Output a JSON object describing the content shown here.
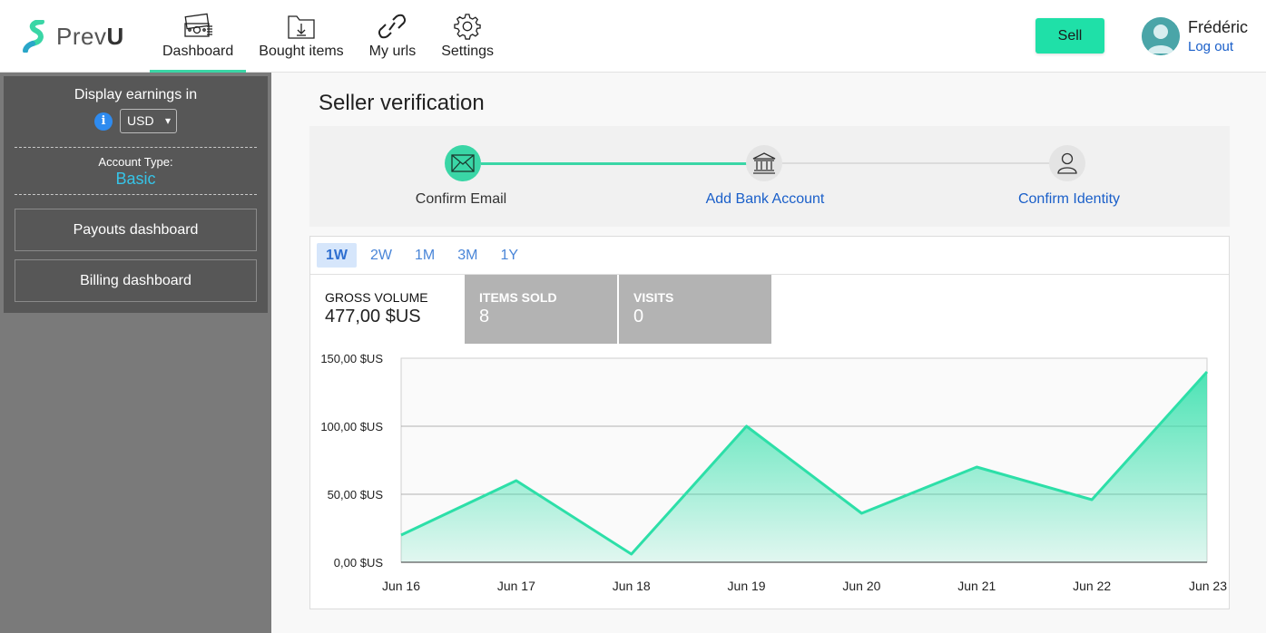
{
  "brand": {
    "name_light": "Prev",
    "name_bold": "U",
    "accent": "#3ad6a6"
  },
  "nav": [
    {
      "label": "Dashboard",
      "icon": "money-icon",
      "active": true
    },
    {
      "label": "Bought items",
      "icon": "download-folder-icon",
      "active": false
    },
    {
      "label": "My urls",
      "icon": "link-icon",
      "active": false
    },
    {
      "label": "Settings",
      "icon": "gear-icon",
      "active": false
    }
  ],
  "header": {
    "sell_label": "Sell",
    "user_name": "Frédéric",
    "logout_label": "Log out"
  },
  "sidebar": {
    "earnings_label": "Display earnings in",
    "info_glyph": "i",
    "currency": "USD",
    "account_type_label": "Account Type:",
    "account_type": "Basic",
    "buttons": [
      "Payouts dashboard",
      "Billing dashboard"
    ]
  },
  "verification": {
    "title": "Seller verification",
    "steps": [
      {
        "label": "Confirm Email",
        "icon": "envelope-icon",
        "done": true
      },
      {
        "label": "Add Bank Account",
        "icon": "bank-icon",
        "done": false
      },
      {
        "label": "Confirm Identity",
        "icon": "person-icon",
        "done": false
      }
    ]
  },
  "ranges": [
    {
      "label": "1W",
      "active": true
    },
    {
      "label": "2W",
      "active": false
    },
    {
      "label": "1M",
      "active": false
    },
    {
      "label": "3M",
      "active": false
    },
    {
      "label": "1Y",
      "active": false
    }
  ],
  "metrics": [
    {
      "label": "GROSS VOLUME",
      "value": "477,00 $US",
      "active": true
    },
    {
      "label": "ITEMS SOLD",
      "value": "8",
      "active": false
    },
    {
      "label": "VISITS",
      "value": "0",
      "active": false
    }
  ],
  "chart_data": {
    "type": "area",
    "x": [
      "Jun 16",
      "Jun 17",
      "Jun 18",
      "Jun 19",
      "Jun 20",
      "Jun 21",
      "Jun 22",
      "Jun 23"
    ],
    "series": [
      {
        "values": [
          20,
          60,
          6,
          100,
          36,
          70,
          46,
          140
        ]
      }
    ],
    "y_ticks": [
      "0,00 $US",
      "50,00 $US",
      "100,00 $US",
      "150,00 $US"
    ],
    "ylim": [
      0,
      150
    ],
    "grid": true,
    "color": "#2ddfa8"
  }
}
